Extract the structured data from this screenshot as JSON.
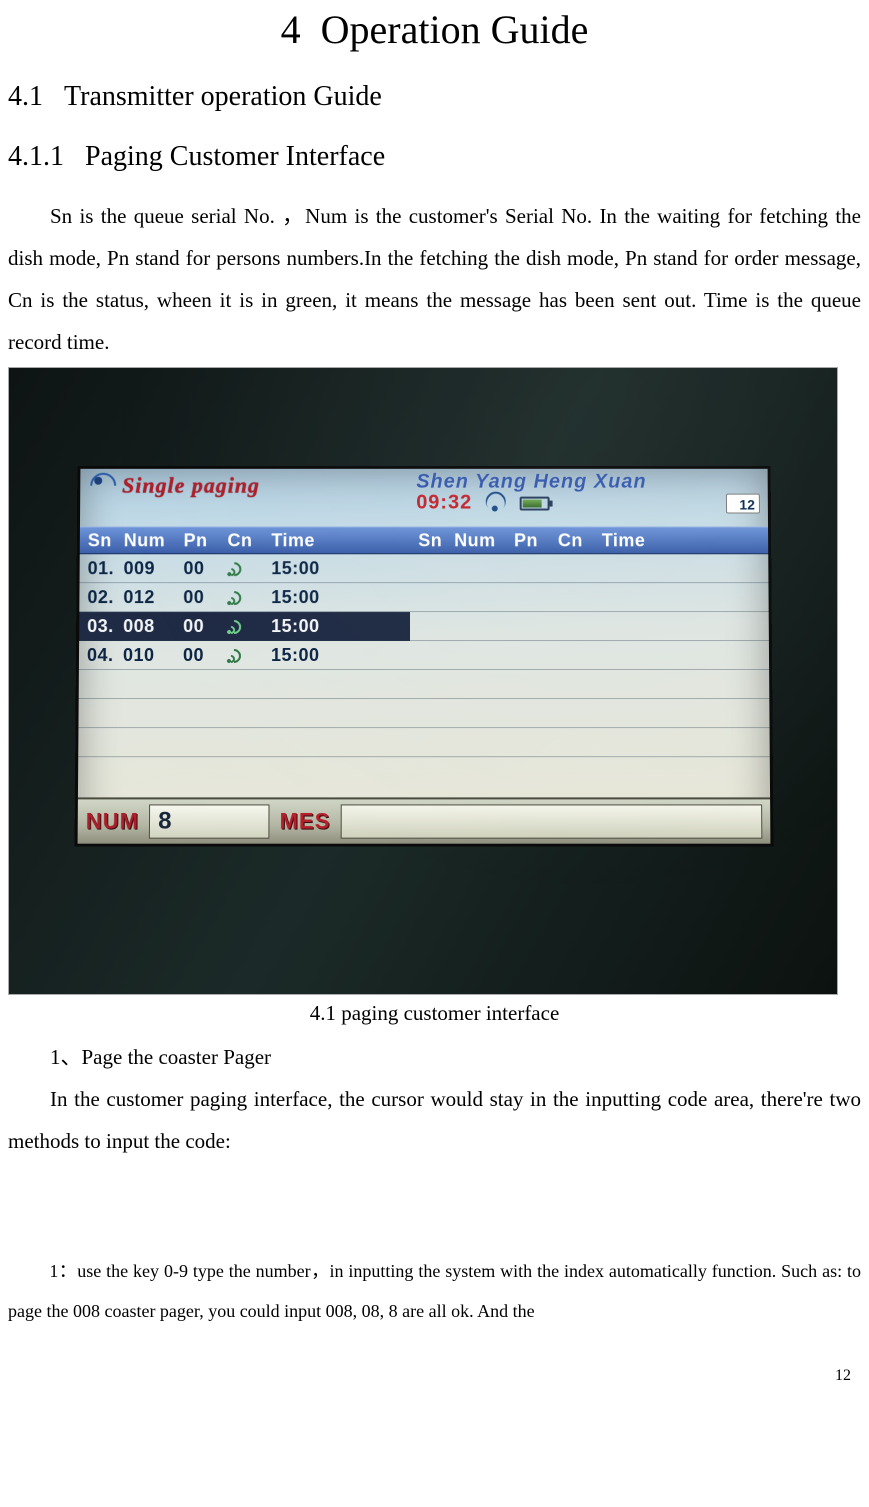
{
  "chapter": {
    "number": "4",
    "title": "Operation Guide"
  },
  "section": {
    "number": "4.1",
    "title": "Transmitter operation Guide"
  },
  "subsection": {
    "number": "4.1.1",
    "title": "Paging Customer Interface"
  },
  "paragraphs": {
    "p1": "Sn is the queue serial No. ，Num is the customer's Serial No. In the waiting for fetching the dish mode, Pn stand for persons numbers.In the fetching the dish mode, Pn stand for order message, Cn is the status, wheen it is in green, it means the message has been sent out.    Time is the queue record time.",
    "caption": "4.1    paging customer interface",
    "p2_title": "1、Page the coaster Pager",
    "p2": "In the customer paging interface, the cursor would stay in the inputting code area, there're two methods to input the code:",
    "p3": "1：use the key 0-9 type the number，in inputting the system with the index automatically function. Such as: to page the 008 coaster pager, you could input 008, 08, 8 are all ok. And the"
  },
  "page_number": "12",
  "device": {
    "logo_text": "Single paging",
    "company": "Shen Yang Heng Xuan",
    "clock": "09:32",
    "count_badge": "12",
    "headers": {
      "sn": "Sn",
      "num": "Num",
      "pn": "Pn",
      "cn": "Cn",
      "time": "Time"
    },
    "rows": [
      {
        "sn": "01.",
        "num": "009",
        "pn": "00",
        "time": "15:00",
        "selected": false
      },
      {
        "sn": "02.",
        "num": "012",
        "pn": "00",
        "time": "15:00",
        "selected": false
      },
      {
        "sn": "03.",
        "num": "008",
        "pn": "00",
        "time": "15:00",
        "selected": true
      },
      {
        "sn": "04.",
        "num": "010",
        "pn": "00",
        "time": "15:00",
        "selected": false
      }
    ],
    "input": {
      "num_label": "NUM",
      "num_value": "8",
      "mes_label": "MES",
      "mes_value": ""
    }
  }
}
